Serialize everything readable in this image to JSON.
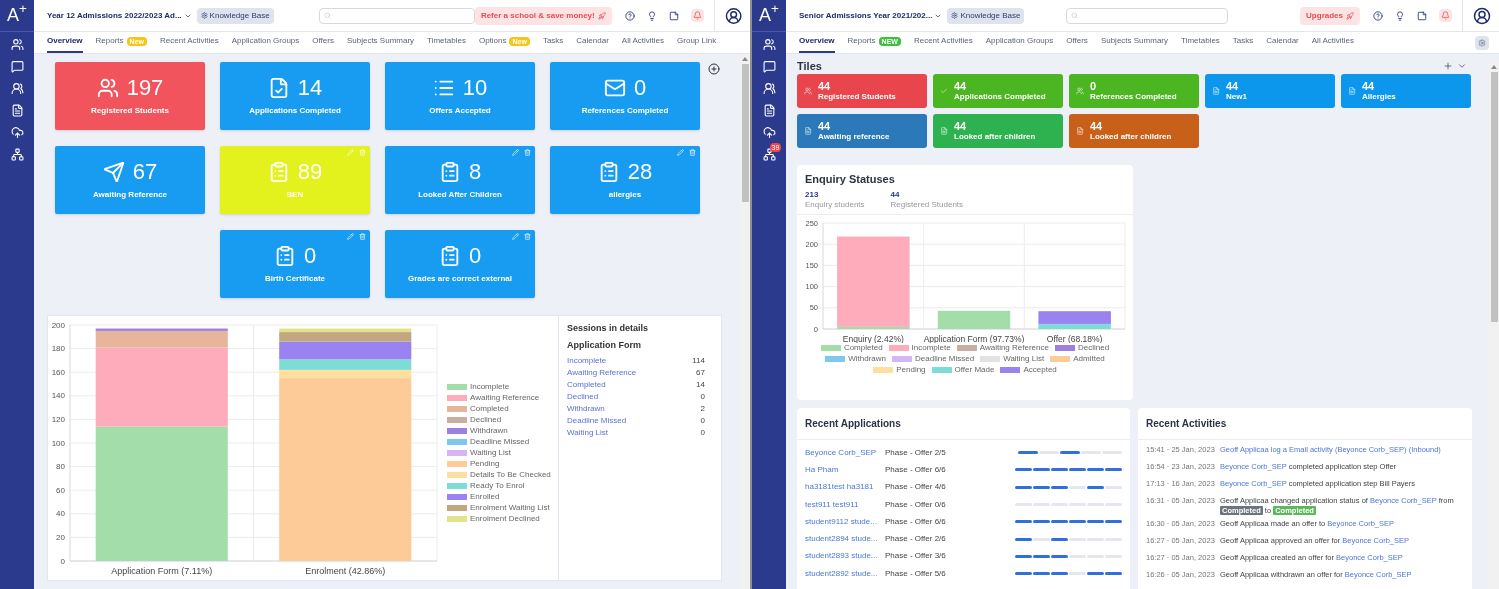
{
  "left": {
    "header": {
      "logo": "A$^{+}$",
      "title": "Year 12 Admissions 2022/2023 Ad...",
      "knowledge_base": "Knowledge Base",
      "promo": "Refer a school & save money!"
    },
    "tabs": [
      {
        "label": "Overview",
        "selected": true
      },
      {
        "label": "Reports",
        "selected": false,
        "badge": {
          "text": "New",
          "color": "#f5c518"
        }
      },
      {
        "label": "Recent Activities",
        "selected": false
      },
      {
        "label": "Application Groups",
        "selected": false
      },
      {
        "label": "Offers",
        "selected": false
      },
      {
        "label": "Subjects Summary",
        "selected": false
      },
      {
        "label": "Timetables",
        "selected": false
      },
      {
        "label": "Options",
        "selected": false,
        "badge": {
          "text": "New",
          "color": "#f5c518"
        }
      },
      {
        "label": "Tasks",
        "selected": false
      },
      {
        "label": "Calendar",
        "selected": false
      },
      {
        "label": "All Activities",
        "selected": false
      },
      {
        "label": "Group Link",
        "selected": false
      }
    ],
    "tiles": [
      [
        {
          "value": "197",
          "label": "Registered Students",
          "color": "#f1545c",
          "editable": false
        },
        {
          "value": "14",
          "label": "Applications Completed",
          "color": "#189cf2",
          "editable": false
        },
        {
          "value": "10",
          "label": "Offers Accepted",
          "color": "#189cf2",
          "editable": false
        },
        {
          "value": "0",
          "label": "References Completed",
          "color": "#189cf2",
          "editable": false
        }
      ],
      [
        {
          "value": "67",
          "label": "Awaiting Reference",
          "color": "#189cf2",
          "editable": false
        },
        {
          "value": "89",
          "label": "SEN",
          "color": "#e3f11c",
          "editable": true
        },
        {
          "value": "8",
          "label": "Looked After Children",
          "color": "#189cf2",
          "editable": true
        },
        {
          "value": "28",
          "label": "allergies",
          "color": "#189cf2",
          "editable": true
        }
      ],
      [
        {
          "value": "0",
          "label": "Birth Certificate",
          "color": "#189cf2",
          "editable": true
        },
        {
          "value": "0",
          "label": "Grades are correct external",
          "color": "#189cf2",
          "editable": true
        }
      ]
    ],
    "chart_card": {
      "chart_data": {
        "type": "bar",
        "stacked": true,
        "grid": true,
        "categories": [
          "Application Form (7.11%)",
          "Enrolment (42.86%)"
        ],
        "ylim": [
          0,
          200
        ],
        "yticks": [
          0,
          20,
          40,
          60,
          80,
          100,
          120,
          140,
          160,
          180,
          200
        ],
        "series": [
          {
            "name": "Incomplete",
            "color": "#a3deaa",
            "values": [
              114,
              0
            ]
          },
          {
            "name": "Awaiting Reference",
            "color": "#feabbb",
            "values": [
              67,
              0
            ]
          },
          {
            "name": "Completed",
            "color": "#e6b59c",
            "values": [
              14,
              0
            ]
          },
          {
            "name": "Declined",
            "color": "#c8aea2",
            "values": [
              0,
              0
            ]
          },
          {
            "name": "Withdrawn",
            "color": "#9d7fe2",
            "values": [
              2,
              0
            ]
          },
          {
            "name": "Deadline Missed",
            "color": "#7ec8ef",
            "values": [
              0,
              0
            ]
          },
          {
            "name": "Waiting List",
            "color": "#d4b6f5",
            "values": [
              0,
              0
            ]
          },
          {
            "name": "Pending",
            "color": "#fccb97",
            "values": [
              0,
              155
            ]
          },
          {
            "name": "Details To Be Checked",
            "color": "#fde0a0",
            "values": [
              0,
              7
            ]
          },
          {
            "name": "Ready To Enrol",
            "color": "#7edcd6",
            "values": [
              0,
              9
            ]
          },
          {
            "name": "Enrolled",
            "color": "#9b82f1",
            "values": [
              0,
              15
            ]
          },
          {
            "name": "Enrolment Waiting List",
            "color": "#c2a67f",
            "values": [
              0,
              8
            ]
          },
          {
            "name": "Enrolment Declined",
            "color": "#e2e28a",
            "values": [
              0,
              3
            ]
          }
        ]
      },
      "details": {
        "title": "Sessions in details",
        "subtitle": "Application Form",
        "rows": [
          {
            "label": "Incomplete",
            "value": "114"
          },
          {
            "label": "Awaiting Reference",
            "value": "67"
          },
          {
            "label": "Completed",
            "value": "14"
          },
          {
            "label": "Declined",
            "value": "0"
          },
          {
            "label": "Withdrawn",
            "value": "2"
          },
          {
            "label": "Deadline Missed",
            "value": "0"
          },
          {
            "label": "Waiting List",
            "value": "0"
          }
        ]
      }
    }
  },
  "right": {
    "header": {
      "logo": "A$^{+}$",
      "title": "Senior Admissions Year 2021/202...",
      "knowledge_base": "Knowledge Base",
      "promo": "Upgrades"
    },
    "sidebar_badge": "39",
    "tabs": [
      {
        "label": "Overview",
        "selected": true
      },
      {
        "label": "Reports",
        "selected": false,
        "badge": {
          "text": "NEW",
          "color": "#3cc13b"
        }
      },
      {
        "label": "Recent Activities",
        "selected": false
      },
      {
        "label": "Application Groups",
        "selected": false
      },
      {
        "label": "Offers",
        "selected": false
      },
      {
        "label": "Subjects Summary",
        "selected": false
      },
      {
        "label": "Timetables",
        "selected": false
      },
      {
        "label": "Tasks",
        "selected": false
      },
      {
        "label": "Calendar",
        "selected": false
      },
      {
        "label": "All Activities",
        "selected": false
      }
    ],
    "tiles_section": {
      "title": "Tiles",
      "tiles": [
        [
          {
            "value": "44",
            "label": "Registered Students",
            "color": "#e8454c"
          },
          {
            "value": "44",
            "label": "Applications Completed",
            "color": "#4cb522"
          },
          {
            "value": "0",
            "label": "References Completed",
            "color": "#4cb522"
          },
          {
            "value": "44",
            "label": "New1",
            "color": "#0d97ec"
          },
          {
            "value": "44",
            "label": "Allergies",
            "color": "#0d97ec"
          }
        ],
        [
          {
            "value": "44",
            "label": "Awaiting reference",
            "color": "#2b79b8"
          },
          {
            "value": "44",
            "label": "Looked after children",
            "color": "#2db24f"
          },
          {
            "value": "44",
            "label": "Looked after children",
            "color": "#c8601a"
          }
        ]
      ]
    },
    "enquiry": {
      "title": "Enquiry Statuses",
      "stats": [
        {
          "value": "213",
          "label": "Enquiry students"
        },
        {
          "value": "44",
          "label": "Registered Students"
        }
      ],
      "chart_data": {
        "type": "bar",
        "stacked": true,
        "grid": true,
        "categories": [
          "Enquiry (2.42%)",
          "Application Form (97.73%)",
          "Offer (68.18%)"
        ],
        "ylim": [
          0,
          250
        ],
        "yticks": [
          0,
          50,
          100,
          150,
          200,
          250
        ],
        "series": [
          {
            "name": "Completed",
            "color": "#a3deaa",
            "values": [
              5,
              43,
              0
            ]
          },
          {
            "name": "Incomplete",
            "color": "#feabbb",
            "values": [
              213,
              0,
              0
            ]
          },
          {
            "name": "Awaiting Reference",
            "color": "#c8aea2",
            "values": [
              0,
              0,
              0
            ]
          },
          {
            "name": "Declined",
            "color": "#9d7fe2",
            "values": [
              0,
              0,
              0
            ]
          },
          {
            "name": "Withdrawn",
            "color": "#7ec8ef",
            "values": [
              0,
              0,
              0
            ]
          },
          {
            "name": "Deadline Missed",
            "color": "#d4b6f5",
            "values": [
              0,
              0,
              0
            ]
          },
          {
            "name": "Waiting List",
            "color": "#e2e2e2",
            "values": [
              0,
              0,
              0
            ]
          },
          {
            "name": "Admitted",
            "color": "#fccb97",
            "values": [
              0,
              0,
              0
            ]
          },
          {
            "name": "Pending",
            "color": "#fde0a0",
            "values": [
              0,
              0,
              0
            ]
          },
          {
            "name": "Offer Made",
            "color": "#7edcd6",
            "values": [
              0,
              0,
              12
            ]
          },
          {
            "name": "Accepted",
            "color": "#9b82f1",
            "values": [
              0,
              0,
              30
            ]
          }
        ]
      }
    },
    "recent_applications": {
      "title": "Recent Applications",
      "rows": [
        {
          "name": "Beyonce Corb_SEP",
          "phase": "Phase - Offer 2/5",
          "steps": [
            true,
            false,
            true,
            false,
            false
          ]
        },
        {
          "name": "Ha Pham",
          "phase": "Phase - Offer 6/6",
          "steps": [
            true,
            true,
            true,
            true,
            true,
            true
          ]
        },
        {
          "name": "ha3181test ha3181",
          "phase": "Phase - Offer 4/6",
          "steps": [
            true,
            true,
            true,
            false,
            true,
            false
          ]
        },
        {
          "name": "test911 test911",
          "phase": "Phase - Offer 0/6",
          "steps": [
            false,
            false,
            false,
            false,
            false,
            false
          ]
        },
        {
          "name": "student9112 stude...",
          "phase": "Phase - Offer 6/6",
          "steps": [
            true,
            true,
            true,
            true,
            true,
            true
          ]
        },
        {
          "name": "student2894 stude...",
          "phase": "Phase - Offer 2/6",
          "steps": [
            true,
            false,
            true,
            false,
            false,
            false
          ]
        },
        {
          "name": "student2893 stude...",
          "phase": "Phase - Offer 3/6",
          "steps": [
            true,
            true,
            true,
            false,
            false,
            false
          ]
        },
        {
          "name": "student2892 stude...",
          "phase": "Phase - Offer 5/6",
          "steps": [
            true,
            true,
            true,
            false,
            true,
            true
          ]
        }
      ]
    },
    "recent_activities": {
      "title": "Recent Activities",
      "rows": [
        {
          "time": "15:41 · 25 Jan, 2023",
          "parts": [
            {
              "kind": "link",
              "text": "Geoff Applicaa log a Email activity (Beyonce Corb_SEP) (Inbound)"
            }
          ]
        },
        {
          "time": "16:54 · 23 Jan, 2023",
          "parts": [
            {
              "kind": "link",
              "text": "Beyonce Corb_SEP"
            },
            {
              "kind": "text",
              "text": " completed application step Offer"
            }
          ]
        },
        {
          "time": "17:13 · 16 Jan, 2023",
          "parts": [
            {
              "kind": "link",
              "text": "Beyonce Corb_SEP"
            },
            {
              "kind": "text",
              "text": " completed application step Bill Payers"
            }
          ]
        },
        {
          "time": "16:31 · 05 Jan, 2023",
          "parts": [
            {
              "kind": "text",
              "text": "Geoff Applicaa changed application status of "
            },
            {
              "kind": "link",
              "text": "Beyonce Corb_SEP"
            },
            {
              "kind": "text",
              "text": " from "
            },
            {
              "kind": "badge",
              "text": "Completed",
              "color": "#6c757d"
            },
            {
              "kind": "text",
              "text": " to "
            },
            {
              "kind": "badge",
              "text": "Completed",
              "color": "#5cb85c"
            }
          ]
        },
        {
          "time": "16:30 · 05 Jan, 2023",
          "parts": [
            {
              "kind": "text",
              "text": "Geoff Applicaa made an offer to "
            },
            {
              "kind": "link",
              "text": "Beyonce Corb_SEP"
            }
          ]
        },
        {
          "time": "16:27 · 05 Jan, 2023",
          "parts": [
            {
              "kind": "text",
              "text": "Geoff Applicaa approved an offer for "
            },
            {
              "kind": "link",
              "text": "Beyonce Corb_SEP"
            }
          ]
        },
        {
          "time": "16:27 · 05 Jan, 2023",
          "parts": [
            {
              "kind": "text",
              "text": "Geoff Applicaa created an offer for "
            },
            {
              "kind": "link",
              "text": "Beyonce Corb_SEP"
            }
          ]
        },
        {
          "time": "16:26 · 05 Jan, 2023",
          "parts": [
            {
              "kind": "text",
              "text": "Geoff Applicaa withdrawn an offer for "
            },
            {
              "kind": "link",
              "text": "Beyonce Corb_SEP"
            }
          ]
        }
      ]
    }
  }
}
